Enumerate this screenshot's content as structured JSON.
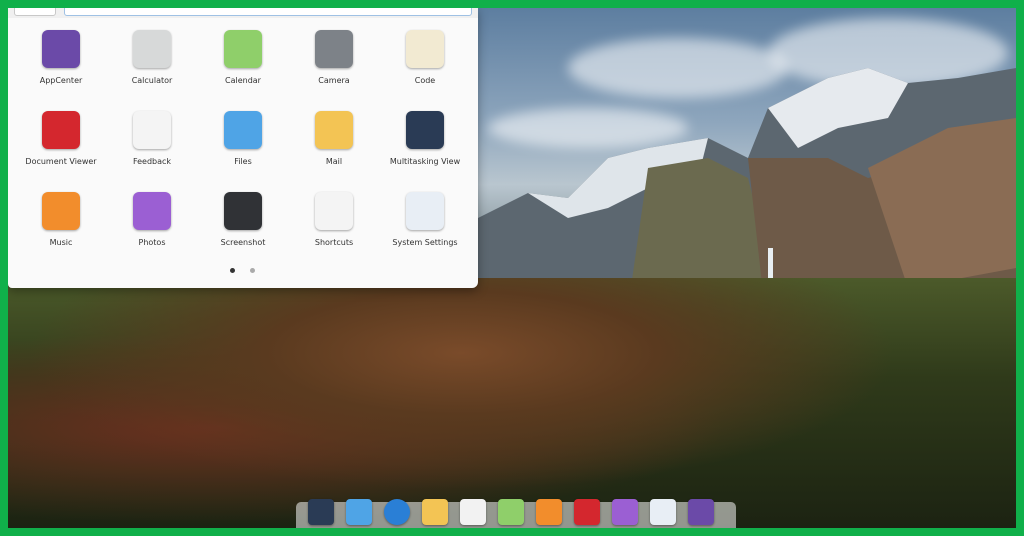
{
  "launcher": {
    "apps": [
      {
        "label": "AppCenter",
        "icon": "appcenter-icon",
        "color": "#6b4aa8"
      },
      {
        "label": "Calculator",
        "icon": "calculator-icon",
        "color": "#d7d9d9"
      },
      {
        "label": "Calendar",
        "icon": "calendar-icon",
        "color": "#8fcf6a"
      },
      {
        "label": "Camera",
        "icon": "camera-icon",
        "color": "#7d8288"
      },
      {
        "label": "Code",
        "icon": "code-icon",
        "color": "#f2ead2"
      },
      {
        "label": "Document Viewer",
        "icon": "document-viewer-icon",
        "color": "#d4272e"
      },
      {
        "label": "Feedback",
        "icon": "feedback-icon",
        "color": "#f4f4f4"
      },
      {
        "label": "Files",
        "icon": "files-icon",
        "color": "#4fa4e6"
      },
      {
        "label": "Mail",
        "icon": "mail-icon",
        "color": "#f3c454"
      },
      {
        "label": "Multitasking View",
        "icon": "multitasking-view-icon",
        "color": "#2a3b55"
      },
      {
        "label": "Music",
        "icon": "music-icon",
        "color": "#f28d2c"
      },
      {
        "label": "Photos",
        "icon": "photos-icon",
        "color": "#9b5fd3"
      },
      {
        "label": "Screenshot",
        "icon": "screenshot-icon",
        "color": "#303236"
      },
      {
        "label": "Shortcuts",
        "icon": "shortcuts-icon",
        "color": "#f4f4f4"
      },
      {
        "label": "System Settings",
        "icon": "system-settings-icon",
        "color": "#e8eef5"
      }
    ],
    "pagination": {
      "pages": 2,
      "current": 1
    }
  },
  "dock": {
    "items": [
      {
        "icon": "multitasking-view-icon",
        "color": "#2a3b55"
      },
      {
        "icon": "files-icon",
        "color": "#4fa4e6"
      },
      {
        "icon": "web-browser-icon",
        "color": "#2a7fd6"
      },
      {
        "icon": "mail-icon",
        "color": "#f3c454"
      },
      {
        "icon": "tasks-icon",
        "color": "#f2f2f2"
      },
      {
        "icon": "calendar-icon",
        "color": "#8fcf6a"
      },
      {
        "icon": "music-icon",
        "color": "#f28d2c"
      },
      {
        "icon": "videos-icon",
        "color": "#d4272e"
      },
      {
        "icon": "photos-icon",
        "color": "#9b5fd3"
      },
      {
        "icon": "system-settings-icon",
        "color": "#e8eef5"
      },
      {
        "icon": "appcenter-icon",
        "color": "#6b4aa8"
      }
    ]
  }
}
